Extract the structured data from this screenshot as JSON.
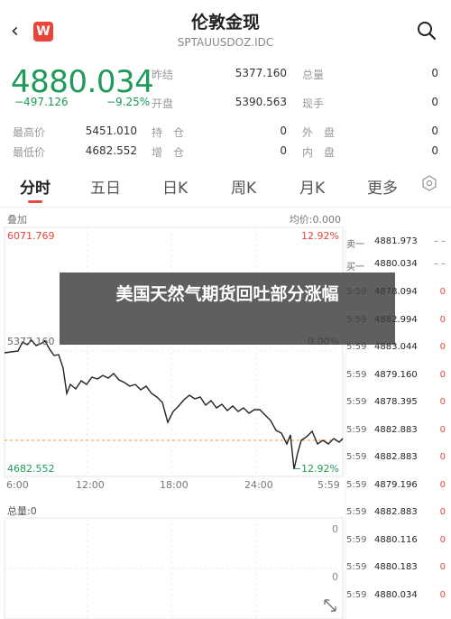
{
  "header": {
    "back_icon": "chevron-left-icon",
    "logo_text": "W",
    "title": "伦敦金现",
    "subtitle": "SPTAUUSDOZ.IDC",
    "search_icon": "search-icon"
  },
  "quote": {
    "price": "4880.034",
    "change": "−497.126",
    "change_pct": "−9.25%",
    "fields": {
      "prev_close_label": "昨结",
      "prev_close": "5377.160",
      "total_vol_label": "总量",
      "total_vol": "0",
      "open_label": "开盘",
      "open": "5390.563",
      "cur_vol_label": "现手",
      "cur_vol": "0",
      "high_label": "最高价",
      "high": "5451.010",
      "hold_label": "持　仓",
      "hold": "0",
      "outer_label": "外　盘",
      "outer": "0",
      "low_label": "最低价",
      "low": "4682.552",
      "add_label": "增　仓",
      "add": "0",
      "inner_label": "内　盘",
      "inner": "0"
    },
    "colors": {
      "down": "#1f9a5a",
      "up": "#e8463a"
    }
  },
  "tabs": [
    "分时",
    "五日",
    "日K",
    "周K",
    "月K",
    "更多"
  ],
  "settings_icon": "settings-icon",
  "chart": {
    "overlay_label": "叠加",
    "avg_label": "均价:0.000",
    "top_price": "6071.769",
    "top_pct": "12.92%",
    "mid_price": "5377.160",
    "mid_pct": "0.00%",
    "bottom_price": "4682.552",
    "bottom_pct": "−12.92%",
    "x_ticks": [
      "6:00",
      "12:00",
      "18:00",
      "24:00",
      "5:59"
    ],
    "volume_label": "总量:0",
    "volume_zero_1": "0",
    "volume_zero_2": "0",
    "expand_icon": "expand-icon"
  },
  "order_book": {
    "ask_label": "卖一",
    "ask_price": "4881.973",
    "ask_vol": "– –",
    "bid_label": "买一",
    "bid_price": "4880.034",
    "bid_vol": "– –",
    "trades": [
      {
        "time": "5:59",
        "price": "4878.094",
        "vol": "0"
      },
      {
        "time": "5:59",
        "price": "4882.994",
        "vol": "0"
      },
      {
        "time": "5:59",
        "price": "4883.044",
        "vol": "0"
      },
      {
        "time": "5:59",
        "price": "4879.160",
        "vol": "0"
      },
      {
        "time": "5:59",
        "price": "4878.395",
        "vol": "0"
      },
      {
        "time": "5:59",
        "price": "4882.883",
        "vol": "0"
      },
      {
        "time": "5:59",
        "price": "4882.883",
        "vol": "0"
      },
      {
        "time": "5:59",
        "price": "4879.196",
        "vol": "0"
      },
      {
        "time": "5:59",
        "price": "4882.883",
        "vol": "0"
      },
      {
        "time": "5:59",
        "price": "4880.116",
        "vol": "0"
      },
      {
        "time": "5:59",
        "price": "4880.183",
        "vol": "0"
      },
      {
        "time": "5:59",
        "price": "4880.034",
        "vol": "0"
      }
    ]
  },
  "banner": {
    "headline": "美国天然气期货回吐部分涨幅"
  }
}
